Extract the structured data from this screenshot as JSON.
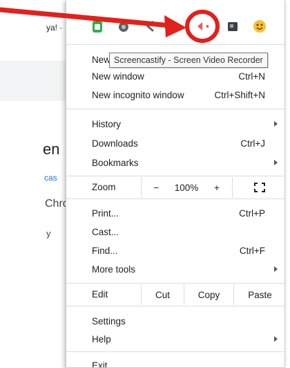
{
  "background": {
    "search_fragment": "ya! ·",
    "heading_fragment": "en",
    "link_fragment": "cas",
    "text_fragment_1": "Chro",
    "text_fragment_2": "y"
  },
  "extensions": [
    {
      "name": "green extension"
    },
    {
      "name": "gray extension"
    },
    {
      "name": "chevron extension"
    },
    {
      "name": "Screencastify"
    },
    {
      "name": "dark extension"
    },
    {
      "name": "emoji extension"
    }
  ],
  "tooltip": "Screencastify - Screen Video Recorder",
  "menu": {
    "new_tab": "New tab",
    "new_window": "New window",
    "new_window_shortcut": "Ctrl+N",
    "new_incognito": "New incognito window",
    "new_incognito_shortcut": "Ctrl+Shift+N",
    "history": "History",
    "downloads": "Downloads",
    "downloads_shortcut": "Ctrl+J",
    "bookmarks": "Bookmarks",
    "zoom_label": "Zoom",
    "zoom_minus": "−",
    "zoom_value": "100%",
    "zoom_plus": "+",
    "print": "Print...",
    "print_shortcut": "Ctrl+P",
    "cast": "Cast...",
    "find": "Find...",
    "find_shortcut": "Ctrl+F",
    "more_tools": "More tools",
    "edit": "Edit",
    "cut": "Cut",
    "copy": "Copy",
    "paste": "Paste",
    "settings": "Settings",
    "help": "Help",
    "exit": "Exit"
  },
  "colors": {
    "annotation_red": "#e3201b",
    "screencastify_red": "#f15a4f"
  }
}
